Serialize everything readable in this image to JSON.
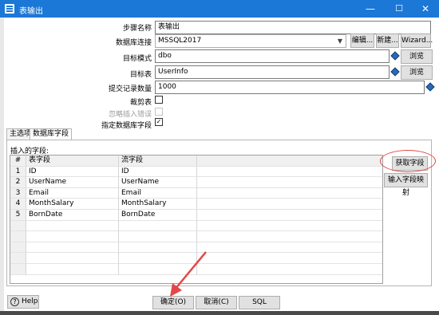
{
  "window": {
    "title": "表输出",
    "minimize": "—",
    "maximize": "☐",
    "close": "✕"
  },
  "form": {
    "step_name_label": "步骤名称",
    "step_name_value": "表输出",
    "connection_label": "数据库连接",
    "connection_value": "MSSQL2017",
    "edit_btn": "编辑...",
    "new_btn": "新建...",
    "wizard_btn": "Wizard...",
    "schema_label": "目标模式",
    "schema_value": "dbo",
    "browse1_btn": "浏览(B)...",
    "table_label": "目标表",
    "table_value": "UserInfo",
    "browse2_btn": "浏览(B)...",
    "commit_label": "提交记录数量",
    "commit_value": "1000",
    "truncate_label": "裁剪表",
    "truncate_checked": false,
    "ignore_errors_label": "忽略插入错误",
    "ignore_errors_checked": false,
    "specify_fields_label": "指定数据库字段",
    "specify_fields_checked": true,
    "check_mark": "✓"
  },
  "tabs": [
    {
      "label": "主选项",
      "active": false
    },
    {
      "label": "数据库字段",
      "active": true
    }
  ],
  "fields_panel": {
    "section_label": "插入的字段:",
    "columns": [
      "#",
      "表字段",
      "流字段"
    ],
    "rows": [
      [
        "1",
        "ID",
        "ID"
      ],
      [
        "2",
        "UserName",
        "UserName"
      ],
      [
        "3",
        "Email",
        "Email"
      ],
      [
        "4",
        "MonthSalary",
        "MonthSalary"
      ],
      [
        "5",
        "BornDate",
        "BornDate"
      ]
    ],
    "get_fields_btn": "获取字段",
    "input_mapping_btn": "输入字段映射"
  },
  "footer": {
    "help_btn": "Help",
    "help_icon_glyph": "?",
    "ok_btn": "确定(O)",
    "cancel_btn": "取消(C)",
    "sql_btn": "SQL"
  },
  "colors": {
    "titlebar": "#1c78d6",
    "annotation_red": "#e34848",
    "variable_icon": "#2a6ab8"
  }
}
